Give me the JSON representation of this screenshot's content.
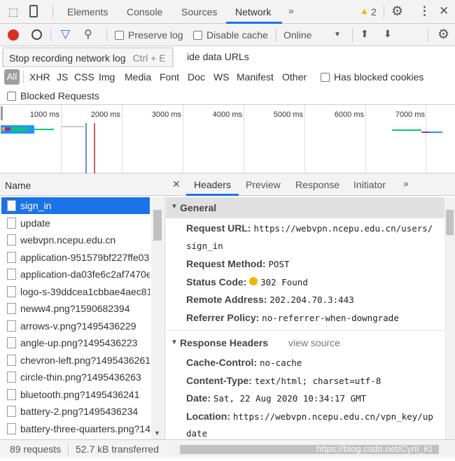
{
  "top_tabs": [
    "Elements",
    "Console",
    "Sources",
    "Network"
  ],
  "active_tab": "Network",
  "warnings": "2",
  "toolbar": {
    "preserve_log": "Preserve log",
    "disable_cache": "Disable cache",
    "throttle": "Online"
  },
  "tooltip": {
    "text": "Stop recording network log",
    "shortcut": "Ctrl + E"
  },
  "hide_data_urls": "ide data URLs",
  "filters": [
    "All",
    "XHR",
    "JS",
    "CSS",
    "Img",
    "Media",
    "Font",
    "Doc",
    "WS",
    "Manifest",
    "Other"
  ],
  "has_blocked_cookies": "Has blocked cookies",
  "blocked_requests": "Blocked Requests",
  "timeline": {
    "ticks": [
      "1000 ms",
      "2000 ms",
      "3000 ms",
      "4000 ms",
      "5000 ms",
      "6000 ms",
      "7000 ms"
    ]
  },
  "name_header": "Name",
  "requests": [
    "sign_in",
    "update",
    "webvpn.ncepu.edu.cn",
    "application-951579bf227ffe03",
    "application-da03fe6c2af7470e",
    "logo-s-39ddcea1cbbae4aec81",
    "neww4.png?1590682394",
    "arrows-v.png?1495436229",
    "angle-up.png?1495436223",
    "chevron-left.png?1495436261",
    "circle-thin.png?1495436263",
    "bluetooth.png?1495436241",
    "battery-2.png?1495436234",
    "battery-three-quarters.png?14"
  ],
  "detail_tabs": [
    "Headers",
    "Preview",
    "Response",
    "Initiator"
  ],
  "general": {
    "title": "General",
    "request_url_label": "Request URL:",
    "request_url": "https://webvpn.ncepu.edu.cn/users/",
    "request_url_cont": "sign_in",
    "method_label": "Request Method:",
    "method": "POST",
    "status_label": "Status Code:",
    "status": "302 Found",
    "status_color": "#f4b400",
    "remote_label": "Remote Address:",
    "remote": "202.204.70.3:443",
    "referrer_label": "Referrer Policy:",
    "referrer": "no-referrer-when-downgrade"
  },
  "response_headers": {
    "title": "Response Headers",
    "view_source": "view source",
    "cache_label": "Cache-Control:",
    "cache": "no-cache",
    "ctype_label": "Content-Type:",
    "ctype": "text/html; charset=utf-8",
    "date_label": "Date:",
    "date": "Sat, 22 Aug 2020 10:34:17 GMT",
    "location_label": "Location:",
    "location": "https://webvpn.ncepu.edu.cn/vpn_key/up",
    "location_cont": "date"
  },
  "footer": {
    "requests": "89 requests",
    "transferred": "52.7 kB transferred"
  },
  "watermark": "https://blog.csdn.net/Cyril_KI",
  "colors": {
    "accent": "#1a73e8",
    "record": "#d93025",
    "warning": "#f4b400"
  }
}
